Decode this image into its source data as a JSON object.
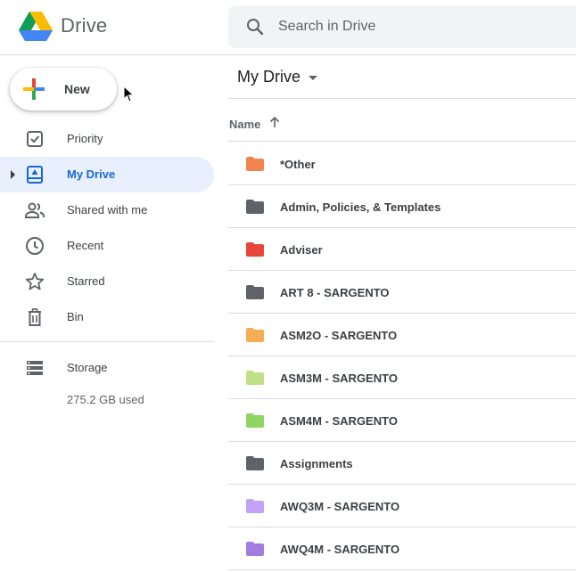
{
  "header": {
    "app_name": "Drive",
    "search": {
      "placeholder": "Search in Drive",
      "value": ""
    }
  },
  "sidebar": {
    "new_label": "New",
    "items": [
      {
        "label": "Priority",
        "icon": "priority-icon"
      },
      {
        "label": "My Drive",
        "icon": "my-drive-icon",
        "active": true
      },
      {
        "label": "Shared with me",
        "icon": "shared-icon"
      },
      {
        "label": "Recent",
        "icon": "clock-icon"
      },
      {
        "label": "Starred",
        "icon": "star-icon"
      },
      {
        "label": "Bin",
        "icon": "trash-icon"
      }
    ],
    "storage": {
      "label": "Storage",
      "used": "275.2 GB used"
    }
  },
  "main": {
    "title": "My Drive",
    "column_name": "Name",
    "folders": [
      {
        "name": "*Other",
        "color": "#f2854f"
      },
      {
        "name": "Admin, Policies, & Templates",
        "color": "#5f6368"
      },
      {
        "name": "Adviser",
        "color": "#e8453c"
      },
      {
        "name": "ART 8 - SARGENTO",
        "color": "#5f6368"
      },
      {
        "name": "ASM2O - SARGENTO",
        "color": "#f6ae55"
      },
      {
        "name": "ASM3M - SARGENTO",
        "color": "#bfe084"
      },
      {
        "name": "ASM4M - SARGENTO",
        "color": "#8fd562"
      },
      {
        "name": "Assignments",
        "color": "#5f6368"
      },
      {
        "name": "AWQ3M - SARGENTO",
        "color": "#c2a2f7"
      },
      {
        "name": "AWQ4M - SARGENTO",
        "color": "#a17ddf"
      }
    ]
  }
}
